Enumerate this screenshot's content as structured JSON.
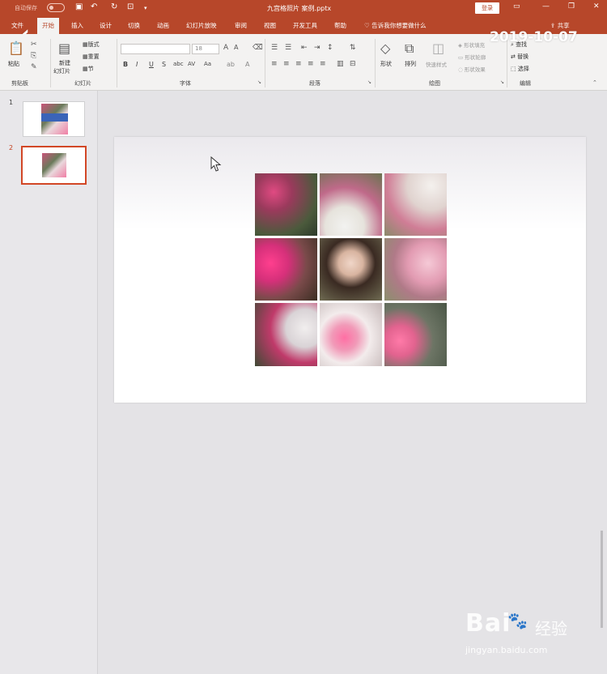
{
  "titlebar": {
    "autosave_label": "自动保存",
    "doc_title": "九宫格照片 案例.pptx",
    "login_label": "登录",
    "brand_color": "#b7472a"
  },
  "tabs": [
    {
      "label": "文件"
    },
    {
      "label": "开始"
    },
    {
      "label": "插入"
    },
    {
      "label": "设计"
    },
    {
      "label": "切换"
    },
    {
      "label": "动画"
    },
    {
      "label": "幻灯片放映"
    },
    {
      "label": "审阅"
    },
    {
      "label": "视图"
    },
    {
      "label": "开发工具"
    },
    {
      "label": "帮助"
    }
  ],
  "tell_me": "告诉我你想要做什么",
  "share_label": "共享",
  "ribbon": {
    "clipboard": {
      "paste": "粘贴",
      "label": "剪贴板"
    },
    "slides": {
      "new_slide_1": "新建",
      "new_slide_2": "幻灯片",
      "layout": "版式",
      "reset": "重置",
      "section": "节",
      "label": "幻灯片"
    },
    "font": {
      "size": "18",
      "bold": "B",
      "italic": "I",
      "underline": "U",
      "strike": "S",
      "spacing": "AV",
      "case": "Aa",
      "label": "字体"
    },
    "paragraph": {
      "label": "段落"
    },
    "drawing": {
      "shapes": "形状",
      "arrange": "排列",
      "quick_styles": "快速样式",
      "fill": "形状填充",
      "outline": "形状轮廓",
      "effects": "形状效果",
      "label": "绘图"
    },
    "editing": {
      "find": "查找",
      "replace": "替换",
      "select": "选择",
      "label": "编辑"
    }
  },
  "date_stamp": "2019-10-07",
  "slides_pane": [
    {
      "number": "1"
    },
    {
      "number": "2"
    }
  ],
  "watermark": {
    "brand": "Bai",
    "sub": "经验",
    "url": "jingyan.baidu.com"
  }
}
